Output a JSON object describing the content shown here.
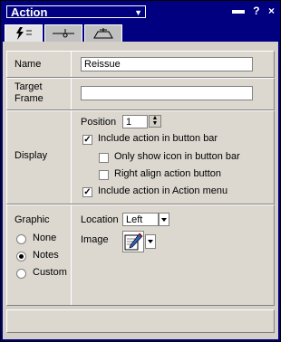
{
  "title": "Action",
  "title_icons": {
    "question": "?",
    "close": "×"
  },
  "tabs": [
    {
      "icon": "lightning-icon"
    },
    {
      "icon": "pin-icon"
    },
    {
      "icon": "hat-icon"
    }
  ],
  "name_row": {
    "label": "Name",
    "value": "Reissue"
  },
  "target_row": {
    "label_line1": "Target",
    "label_line2": "Frame",
    "value": ""
  },
  "display_row": {
    "label": "Display",
    "position_label": "Position",
    "position_value": "1",
    "options": [
      {
        "label": "Include action in button bar",
        "checked": true
      },
      {
        "label": "Only show icon in button bar",
        "checked": false
      },
      {
        "label": "Right align action button",
        "checked": false
      },
      {
        "label": "Include action in Action menu",
        "checked": true
      }
    ]
  },
  "graphic_row": {
    "label": "Graphic",
    "radios": [
      {
        "label": "None",
        "selected": false
      },
      {
        "label": "Notes",
        "selected": true
      },
      {
        "label": "Custom",
        "selected": false
      }
    ],
    "location_label": "Location",
    "location_value": "Left",
    "image_label": "Image",
    "image_icon": "pencil-icon"
  }
}
